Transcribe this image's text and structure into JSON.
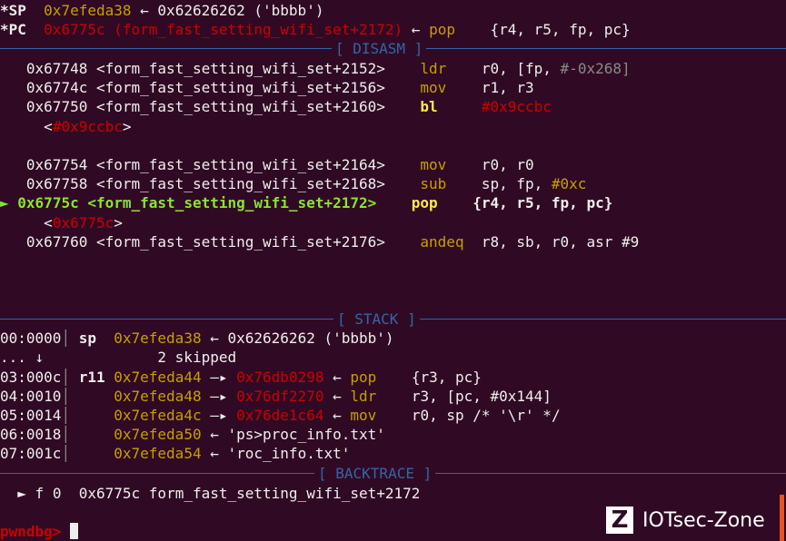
{
  "registers": {
    "sp": {
      "name": "*SP",
      "addr": "0x7efeda38",
      "arrow": "←",
      "ptr": "0x62626262",
      "str": "('bbbb')"
    },
    "pc": {
      "name": "*PC",
      "addr": "0x6775c",
      "sym": "(form_fast_setting_wifi_set+2172)",
      "arrow": "←",
      "mnem": "pop",
      "ops": "{r4, r5, fp, pc}"
    }
  },
  "sections": {
    "disasm": "[ DISASM ]",
    "stack": "[ STACK ]",
    "backtrace": "[ BACKTRACE ]"
  },
  "disasm": {
    "marker": "►",
    "lines": [
      {
        "addr": "0x67748",
        "sym": "<form_fast_setting_wifi_set+2152>",
        "mnem": "ldr",
        "ops": "r0, [fp, ",
        "ops2": "#-0x268]"
      },
      {
        "addr": "0x6774c",
        "sym": "<form_fast_setting_wifi_set+2156>",
        "mnem": "mov",
        "ops": "r1, r3"
      },
      {
        "addr": "0x67750",
        "sym": "<form_fast_setting_wifi_set+2160>",
        "mnem": "bl",
        "ops": "#0x9ccbc",
        "sub": "<0x9ccbc>"
      },
      {
        "addr": "0x67754",
        "sym": "<form_fast_setting_wifi_set+2164>",
        "mnem": "mov",
        "ops": "r0, r0"
      },
      {
        "addr": "0x67758",
        "sym": "<form_fast_setting_wifi_set+2168>",
        "mnem": "sub",
        "ops": "sp, fp, ",
        "ops2": "#0xc"
      },
      {
        "addr": "0x6775c",
        "sym": "<form_fast_setting_wifi_set+2172>",
        "mnem": "pop",
        "ops": "{r4, r5, fp, pc}",
        "sub": "<0x6775c>"
      },
      {
        "addr": "0x67760",
        "sym": "<form_fast_setting_wifi_set+2176>",
        "mnem": "andeq",
        "ops": "r8, sb, r0, asr #9"
      }
    ]
  },
  "stack": [
    {
      "off": "00:0000",
      "reg": "sp",
      "addr": "0x7efeda38",
      "a1": "←",
      "val": "0x62626262",
      "rest": "('bbbb')"
    },
    {
      "off": "... ↓",
      "skip": "2 skipped"
    },
    {
      "off": "03:000c",
      "reg": "r11",
      "addr": "0x7efeda44",
      "a1": "—▸",
      "val": "0x76db0298",
      "a2": "←",
      "mnem": "pop",
      "ops": "{r3, pc}"
    },
    {
      "off": "04:0010",
      "reg": "",
      "addr": "0x7efeda48",
      "a1": "—▸",
      "val": "0x76df2270",
      "a2": "←",
      "mnem": "ldr",
      "ops": "r3, [pc, #0x144]"
    },
    {
      "off": "05:0014",
      "reg": "",
      "addr": "0x7efeda4c",
      "a1": "—▸",
      "val": "0x76de1c64",
      "a2": "←",
      "mnem": "mov",
      "ops": "r0, sp /* '\\r' */"
    },
    {
      "off": "06:0018",
      "reg": "",
      "addr": "0x7efeda50",
      "a1": "←",
      "str": "'ps>proc_info.txt'"
    },
    {
      "off": "07:001c",
      "reg": "",
      "addr": "0x7efeda54",
      "a1": "←",
      "str": "'roc_info.txt'"
    }
  ],
  "backtrace": {
    "marker": "►",
    "frame": "f 0",
    "addr": "0x6775c",
    "sym": "form_fast_setting_wifi_set+2172"
  },
  "prompt": "pwndbg>",
  "watermark": {
    "logo": "Z",
    "text": "IOTsec-Zone"
  },
  "colors": {
    "bg": "#300a24",
    "separator": "#3465a4",
    "address": "#c4a000",
    "pointer": "#cc0000",
    "current": "#8ae234",
    "mnemonic": "#c4a000"
  }
}
